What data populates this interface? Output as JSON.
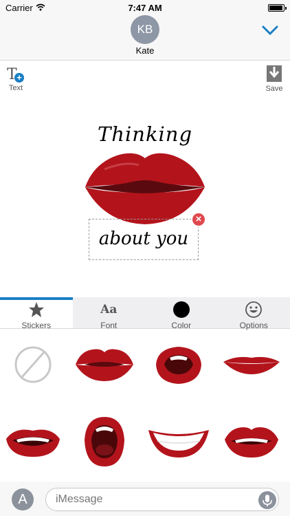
{
  "status_bar": {
    "carrier": "Carrier",
    "time": "7:47 AM",
    "battery_level": 0.95
  },
  "header": {
    "avatar_initials": "KB",
    "contact_name": "Kate",
    "collapse_icon": "chevron-down-icon"
  },
  "toolbar": {
    "text_label": "Text",
    "save_label": "Save"
  },
  "canvas": {
    "top_text": "Thinking",
    "box_text": "about you"
  },
  "tabs": [
    {
      "label": "Stickers",
      "icon": "star-icon",
      "active": true
    },
    {
      "label": "Font",
      "icon": "font-icon",
      "glyph": "Aa",
      "active": false
    },
    {
      "label": "Color",
      "icon": "color-circle-icon",
      "active": false
    },
    {
      "label": "Options",
      "icon": "smiley-icon",
      "active": false
    }
  ],
  "stickers": [
    "none",
    "closed-lips",
    "open-lips-teeth",
    "thin-lips",
    "smile-teeth",
    "open-mouth",
    "wide-smile",
    "parted-lips"
  ],
  "input_bar": {
    "placeholder": "iMessage"
  },
  "colors": {
    "lip_red": "#b3141c",
    "accent_blue": "#1a7fc4",
    "delete_red": "#e0484d"
  }
}
